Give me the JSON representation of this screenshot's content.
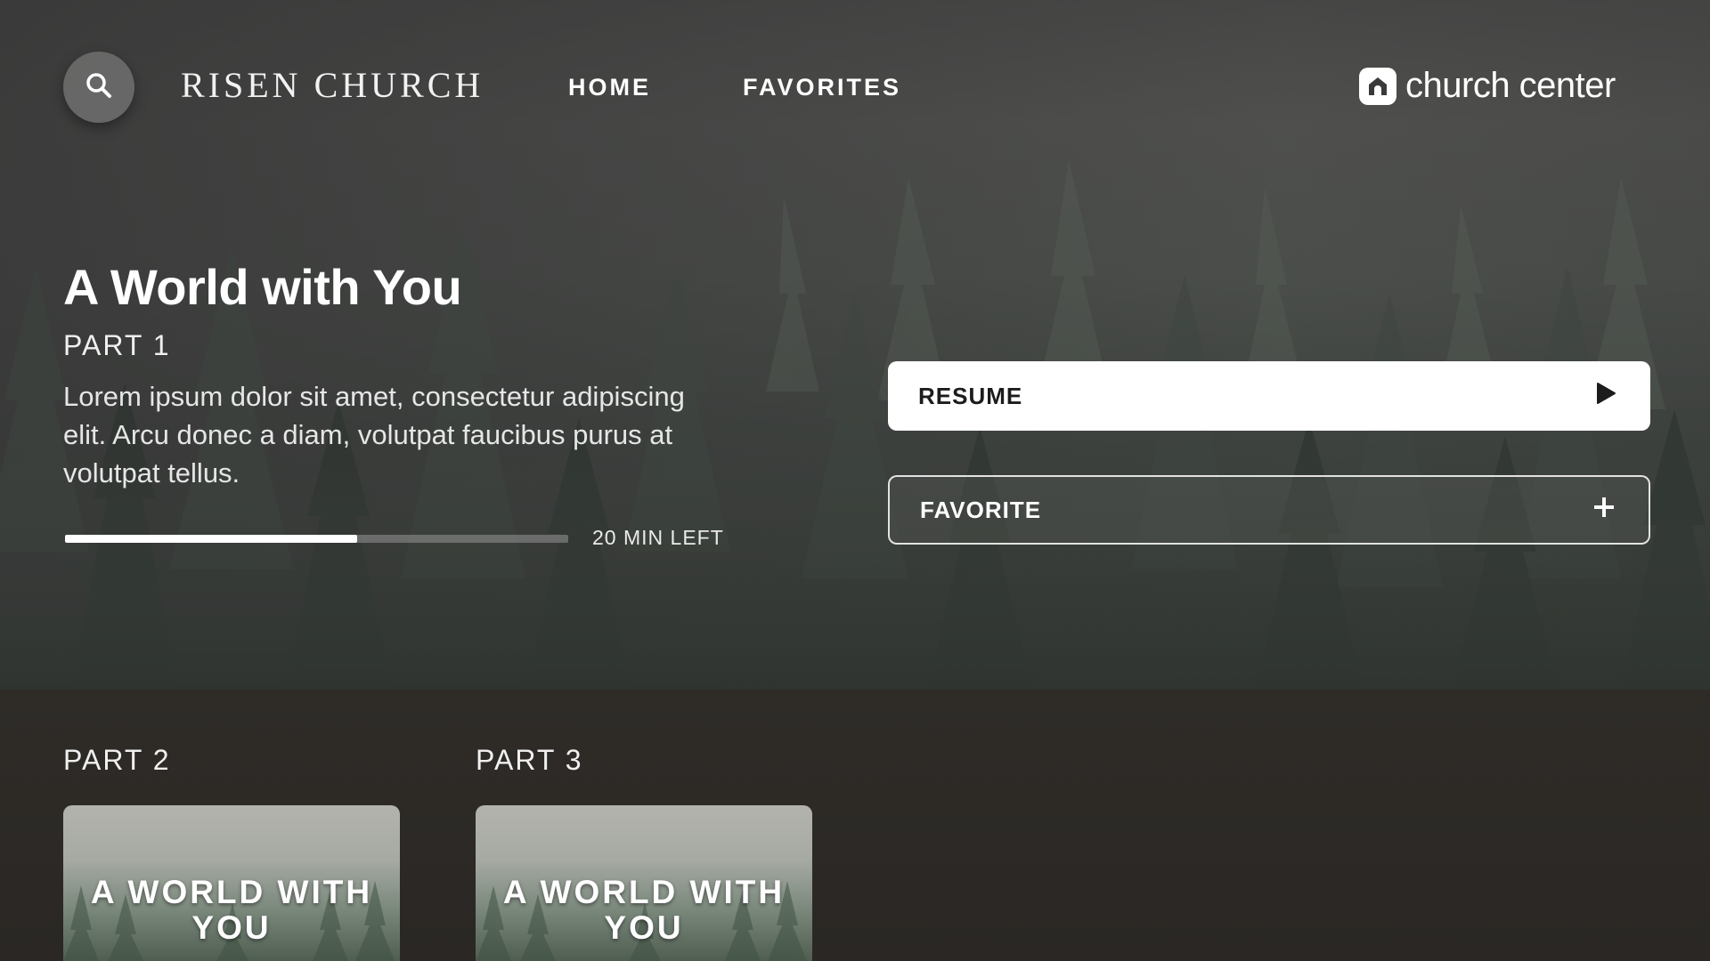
{
  "header": {
    "search_icon": "search-icon",
    "brand": "RISEN CHURCH",
    "nav": [
      {
        "label": "HOME"
      },
      {
        "label": "FAVORITES"
      }
    ],
    "logo_text": "church center",
    "logo_icon": "home-icon"
  },
  "hero": {
    "title": "A World with You",
    "subtitle": "PART 1",
    "description": "Lorem ipsum dolor sit amet, consectetur adipiscing elit. Arcu donec a diam, volutpat faucibus purus at volutpat tellus.",
    "progress_fraction": 0.58,
    "time_left": "20 MIN LEFT"
  },
  "actions": {
    "resume_label": "RESUME",
    "resume_icon": "play-icon",
    "favorite_label": "FAVORITE",
    "favorite_icon": "plus-icon"
  },
  "episodes": [
    {
      "label": "PART 2",
      "card_title": "A WORLD WITH YOU"
    },
    {
      "label": "PART 3",
      "card_title": "A WORLD WITH YOU"
    }
  ],
  "colors": {
    "background_dark": "#2c2a27",
    "text": "#ffffff",
    "resume_bg": "#ffffff"
  }
}
